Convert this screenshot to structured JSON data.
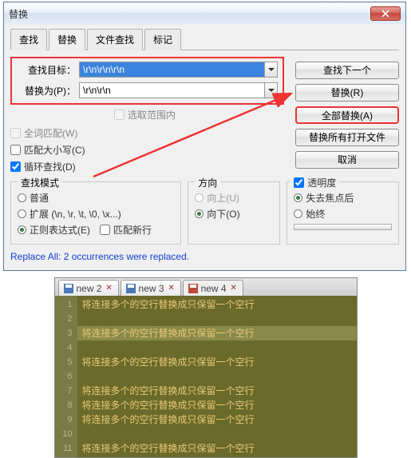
{
  "dialog": {
    "title": "替换",
    "tabs": [
      "查找",
      "替换",
      "文件查找",
      "标记"
    ],
    "active_tab": 1,
    "find_label": "查找目标：",
    "find_value": "\\r\\n\\r\\n\\r\\n",
    "replace_label": "替换为(P)：",
    "replace_value": "\\r\\n\\r\\n",
    "range_label": "选取范围内",
    "buttons": {
      "find_next": "查找下一个",
      "replace": "替换(R)",
      "replace_all": "全部替换(A)",
      "replace_in_open": "替换所有打开文件",
      "cancel": "取消"
    },
    "opts": {
      "whole_word": "全词匹配(W)",
      "match_case": "匹配大小写(C)",
      "wrap": "循环查找(D)"
    },
    "mode": {
      "legend": "查找模式",
      "normal": "普通",
      "extended": "扩展 (\\n, \\r, \\t, \\0, \\x...)",
      "regex": "正则表达式(E)",
      "newline": "匹配新行"
    },
    "direction": {
      "legend": "方向",
      "up": "向上(U)",
      "down": "向下(O)"
    },
    "transparency": {
      "legend": "透明度",
      "on_lose_focus": "失去焦点后",
      "always": "始终"
    },
    "status": "Replace All: 2 occurrences were replaced."
  },
  "editor": {
    "tabs": [
      {
        "name": "new 2",
        "modified": false,
        "selected": false
      },
      {
        "name": "new 3",
        "modified": false,
        "selected": false
      },
      {
        "name": "new 4",
        "modified": true,
        "selected": true
      }
    ],
    "text_line": "将连接多个的空行替换成只保留一个空行",
    "line_numbers": [
      1,
      2,
      3,
      4,
      5,
      6,
      7,
      8,
      9,
      10,
      11
    ],
    "content_rows": [
      1,
      3,
      5,
      7,
      8,
      9,
      11
    ],
    "highlighted_row": 3
  }
}
